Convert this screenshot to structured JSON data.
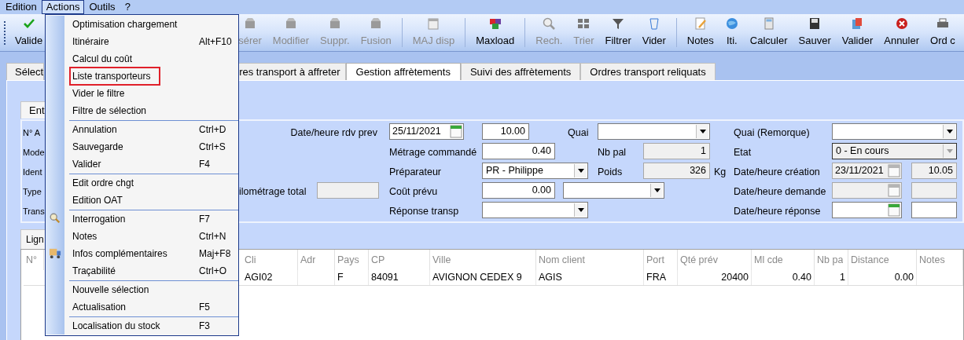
{
  "menubar": [
    {
      "label": "Edition",
      "selected": false
    },
    {
      "label": "Actions",
      "selected": true
    },
    {
      "label": "Outils",
      "selected": false
    },
    {
      "label": "?",
      "selected": false
    }
  ],
  "toolbar": [
    {
      "kind": "button",
      "label": "Valide",
      "disabled": false
    },
    {
      "kind": "button",
      "label": "sérer",
      "disabled": true
    },
    {
      "kind": "button",
      "label": "Modifier",
      "disabled": true
    },
    {
      "kind": "button",
      "label": "Suppr.",
      "disabled": true
    },
    {
      "kind": "button",
      "label": "Fusion",
      "disabled": true
    },
    {
      "kind": "separator"
    },
    {
      "kind": "button",
      "label": "MAJ disp",
      "disabled": true
    },
    {
      "kind": "separator"
    },
    {
      "kind": "button",
      "label": "Maxload",
      "disabled": false
    },
    {
      "kind": "separator"
    },
    {
      "kind": "button",
      "label": "Rech.",
      "disabled": true
    },
    {
      "kind": "button",
      "label": "Trier",
      "disabled": true
    },
    {
      "kind": "button",
      "label": "Filtrer",
      "disabled": false
    },
    {
      "kind": "button",
      "label": "Vider",
      "disabled": false
    },
    {
      "kind": "separator"
    },
    {
      "kind": "button",
      "label": "Notes",
      "disabled": false
    },
    {
      "kind": "button",
      "label": "Iti.",
      "disabled": false
    },
    {
      "kind": "button",
      "label": "Calculer",
      "disabled": false
    },
    {
      "kind": "button",
      "label": "Sauver",
      "disabled": false
    },
    {
      "kind": "button",
      "label": "Valider",
      "disabled": false
    },
    {
      "kind": "button",
      "label": "Annuler",
      "disabled": false
    },
    {
      "kind": "button",
      "label": "Ord c",
      "disabled": false
    }
  ],
  "tabs": [
    {
      "label": "Sélect",
      "selected": false
    },
    {
      "label": "res transport à affreter",
      "selected": false
    },
    {
      "label": "Gestion affrètements",
      "selected": true
    },
    {
      "label": "Suivi des affrètements",
      "selected": false
    },
    {
      "label": "Ordres transport reliquats",
      "selected": false
    }
  ],
  "header_tab": {
    "label": "Ent"
  },
  "form": {
    "left_labels": [
      "N° A",
      "Mode",
      "Ident",
      "Type",
      "Trans"
    ],
    "kilometrage": {
      "label": "ilométrage total",
      "disabled": true
    },
    "rdv": {
      "label": "Date/heure rdv prev",
      "date": "25/11/2021",
      "time": "10.00"
    },
    "quai": {
      "label": "Quai"
    },
    "metrage": {
      "label": "Métrage commandé",
      "value": "0.40"
    },
    "nb_pal": {
      "label": "Nb pal",
      "value": "1",
      "disabled": true
    },
    "preparateur": {
      "label": "Préparateur",
      "value": "PR - Philippe"
    },
    "poids": {
      "label": "Poids",
      "value": "326",
      "unit": "Kg",
      "disabled": true
    },
    "cout": {
      "label": "Coût prévu",
      "value": "0.00"
    },
    "reponse_transp": {
      "label": "Réponse transp"
    },
    "quai_remorque": {
      "label": "Quai (Remorque)"
    },
    "etat": {
      "label": "Etat",
      "value": "0 - En cours",
      "disabled": true
    },
    "creation": {
      "label": "Date/heure création",
      "date": "23/11/2021",
      "time": "10.05",
      "disabled": true
    },
    "demande": {
      "label": "Date/heure demande",
      "disabled": true
    },
    "reponse": {
      "label": "Date/heure réponse",
      "disabled": false
    }
  },
  "lines_tab": {
    "label": "Lign"
  },
  "table": {
    "columns": {
      "num": "N°",
      "cli": "Cli",
      "adr": "Adr",
      "pays": "Pays",
      "cp": "CP",
      "ville": "Ville",
      "nom": "Nom client",
      "port": "Port",
      "qte": "Qté prév",
      "ml": "Ml cde",
      "nbpal": "Nb pa",
      "distance": "Distance",
      "notes": "Notes"
    },
    "rows": [
      {
        "cli": "AGI02",
        "pays": "F",
        "cp": "84091",
        "ville": "AVIGNON CEDEX 9",
        "nom": "AGIS",
        "port": "FRA",
        "qte": "20400",
        "ml": "0.40",
        "nbpal": "1",
        "distance": "0.00"
      }
    ]
  },
  "menu": [
    {
      "kind": "item",
      "label": "Optimisation chargement",
      "selected": false
    },
    {
      "kind": "item",
      "label": "Itinéraire",
      "shortcut": "Alt+F10",
      "selected": false
    },
    {
      "kind": "item",
      "label": "Calcul du coût",
      "selected": false
    },
    {
      "kind": "item",
      "label": "Liste transporteurs",
      "selected": true
    },
    {
      "kind": "item",
      "label": "Vider le filtre",
      "selected": false
    },
    {
      "kind": "item",
      "label": "Filtre de sélection",
      "selected": false
    },
    {
      "kind": "separator"
    },
    {
      "kind": "item",
      "label": "Annulation",
      "shortcut": "Ctrl+D",
      "selected": false
    },
    {
      "kind": "item",
      "label": "Sauvegarde",
      "shortcut": "Ctrl+S",
      "selected": false
    },
    {
      "kind": "item",
      "label": "Valider",
      "shortcut": "F4",
      "selected": false
    },
    {
      "kind": "separator"
    },
    {
      "kind": "item",
      "label": "Edit ordre chgt",
      "selected": false
    },
    {
      "kind": "item",
      "label": "Edition OAT",
      "selected": false
    },
    {
      "kind": "separator"
    },
    {
      "kind": "search_item",
      "label": "Interrogation",
      "shortcut": "F7",
      "selected": false
    },
    {
      "kind": "item",
      "label": "Notes",
      "shortcut": "Ctrl+N",
      "selected": false
    },
    {
      "kind": "truck_item",
      "label": "Infos complémentaires",
      "shortcut": "Maj+F8",
      "selected": false
    },
    {
      "kind": "item",
      "label": "Traçabilité",
      "shortcut": "Ctrl+O",
      "selected": false
    },
    {
      "kind": "separator"
    },
    {
      "kind": "item",
      "label": "Nouvelle sélection",
      "selected": false
    },
    {
      "kind": "item",
      "label": "Actualisation",
      "shortcut": "F5",
      "selected": false
    },
    {
      "kind": "separator"
    },
    {
      "kind": "item",
      "label": "Localisation du stock",
      "shortcut": "F3",
      "selected": false
    }
  ]
}
